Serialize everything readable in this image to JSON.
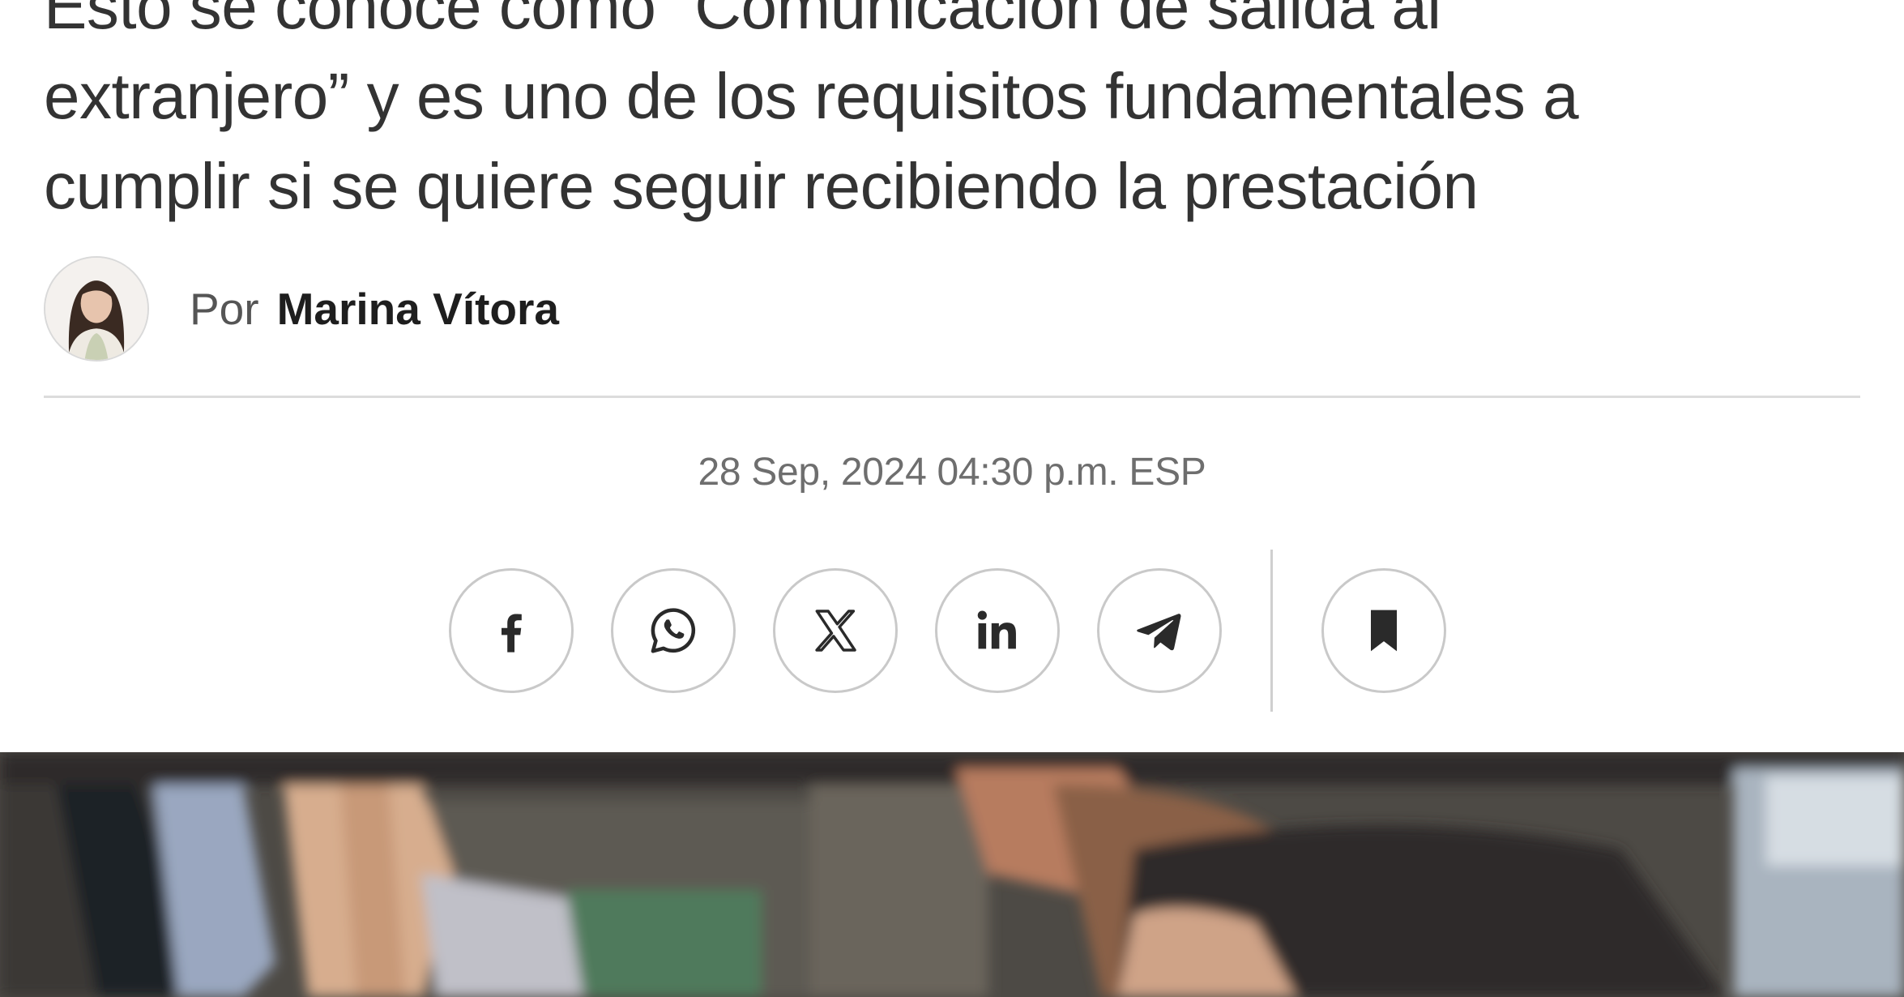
{
  "article": {
    "subtitle_lines": [
      "Esto se conoce como “Comunicación de salida al",
      "extranjero” y es uno de los requisitos fundamentales a",
      "cumplir si se quiere seguir recibiendo la prestación"
    ],
    "author": {
      "prefix": "Por",
      "name": "Marina Vítora"
    },
    "timestamp": "28 Sep, 2024 04:30 p.m. ESP"
  },
  "share": {
    "buttons": [
      {
        "icon": "facebook-icon"
      },
      {
        "icon": "whatsapp-icon"
      },
      {
        "icon": "x-icon"
      },
      {
        "icon": "linkedin-icon"
      },
      {
        "icon": "telegram-icon"
      }
    ],
    "save_icon": "bookmark-icon"
  },
  "colors": {
    "text": "#333333",
    "muted": "#6e6e6e",
    "icon": "#2a2a2a",
    "border": "#c9c9c9"
  }
}
